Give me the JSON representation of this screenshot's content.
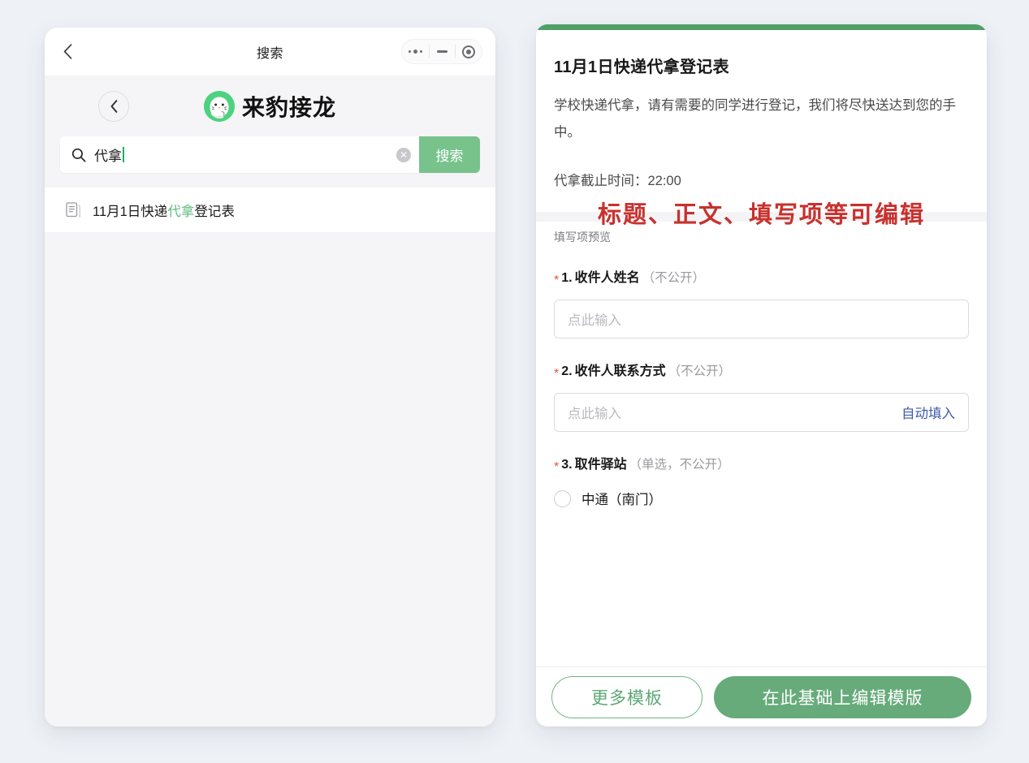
{
  "page": {
    "background_color": "#eef1f6"
  },
  "left_window": {
    "titlebar": {
      "back_icon": "chevron-left-icon",
      "title": "搜索",
      "controls": [
        {
          "icon": "more-dots-icon",
          "name": "more-options"
        },
        {
          "icon": "minimize-icon",
          "name": "minimize"
        },
        {
          "icon": "target-circle-icon",
          "name": "close"
        }
      ]
    },
    "app_header": {
      "back_icon": "chevron-left-circle-icon",
      "avatar_icon": "seal-mascot-avatar",
      "avatar_bg_color": "#4dd27f",
      "title": "来豹接龙"
    },
    "search": {
      "icon": "search-icon",
      "value": "代拿",
      "placeholder": "搜索",
      "clear_icon": "clear-circle-icon",
      "clear_glyph": "✕",
      "submit_label": "搜索",
      "submit_color": "#78c28c",
      "caret_color": "#18b566"
    },
    "results": [
      {
        "icon": "document-icon",
        "prefix": "11月1日快递",
        "match": "代拿",
        "suffix": "登记表",
        "match_color": "#5fbd7e"
      }
    ]
  },
  "right_panel": {
    "accent_bar_color": "#4f9f66",
    "template": {
      "title": "11月1日快递代拿登记表",
      "description": "学校快递代拿，请有需要的同学进行登记，我们将尽快送达到您的手中。",
      "deadline": "代拿截止时间：22:00"
    },
    "annotation": {
      "text": "标题、正文、填写项等可编辑",
      "color": "#c8312d"
    },
    "preview_label": "填写项预览",
    "fields": [
      {
        "required": true,
        "star": "*",
        "index": "1.",
        "label": "收件人姓名",
        "hint": "（不公开）",
        "input_placeholder": "点此输入",
        "action": null
      },
      {
        "required": true,
        "star": "*",
        "index": "2.",
        "label": "收件人联系方式",
        "hint": "（不公开）",
        "input_placeholder": "点此输入",
        "action": "自动填入",
        "action_color": "#3e5aa8"
      },
      {
        "required": true,
        "star": "*",
        "index": "3.",
        "label": "取件驿站",
        "hint": "（单选，不公开）",
        "options": [
          {
            "label": "中通（南门）",
            "selected": false
          }
        ]
      }
    ],
    "footer": {
      "secondary_label": "更多模板",
      "primary_label": "在此基础上编辑模版",
      "primary_color": "#67ab7b",
      "secondary_border_color": "#6fb785"
    }
  }
}
